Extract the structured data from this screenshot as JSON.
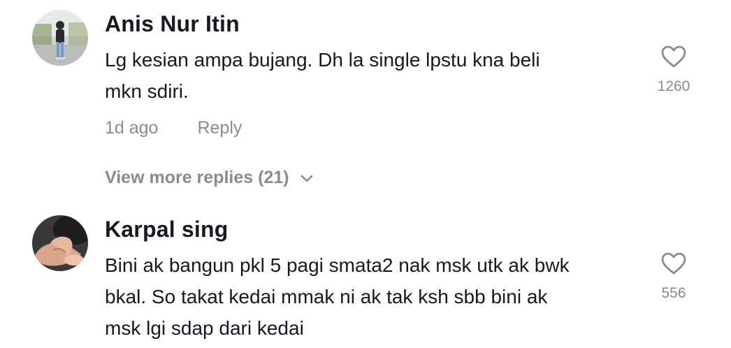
{
  "comments": [
    {
      "username": "Anis Nur Itin",
      "text_line1": "Lg kesian ampa bujang. Dh la single lpstu kna beli",
      "text_line2": "mkn sdiri.",
      "time": "1d ago",
      "reply_label": "Reply",
      "like_count": "1260",
      "view_more_label": "View more replies (21)"
    },
    {
      "username": "Karpal sing",
      "text_line1": "Bini ak bangun pkl 5 pagi smata2 nak msk utk ak bwk",
      "text_line2": "bkal. So takat kedai mmak ni ak tak ksh sbb bini ak",
      "text_line3": "msk lgi sdap dari kedai",
      "like_count": "556"
    }
  ],
  "icons": {
    "like": "heart-outline-icon",
    "expand": "chevron-down-icon"
  },
  "colors": {
    "text": "#161823",
    "muted": "#8a8b91"
  }
}
